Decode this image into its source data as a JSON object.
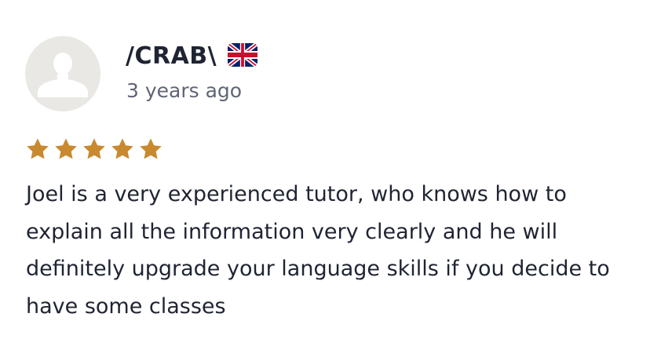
{
  "review": {
    "reviewer_name": "/CRAB\\",
    "country_flag": "uk-flag-icon",
    "date": "3 years ago",
    "rating": 5,
    "rating_max": 5,
    "star_color": "#c9892e",
    "text": "Joel is a very experienced tutor, who knows how to explain all the information very clearly and he will definitely upgrade your language skills if you decide to have some classes"
  }
}
